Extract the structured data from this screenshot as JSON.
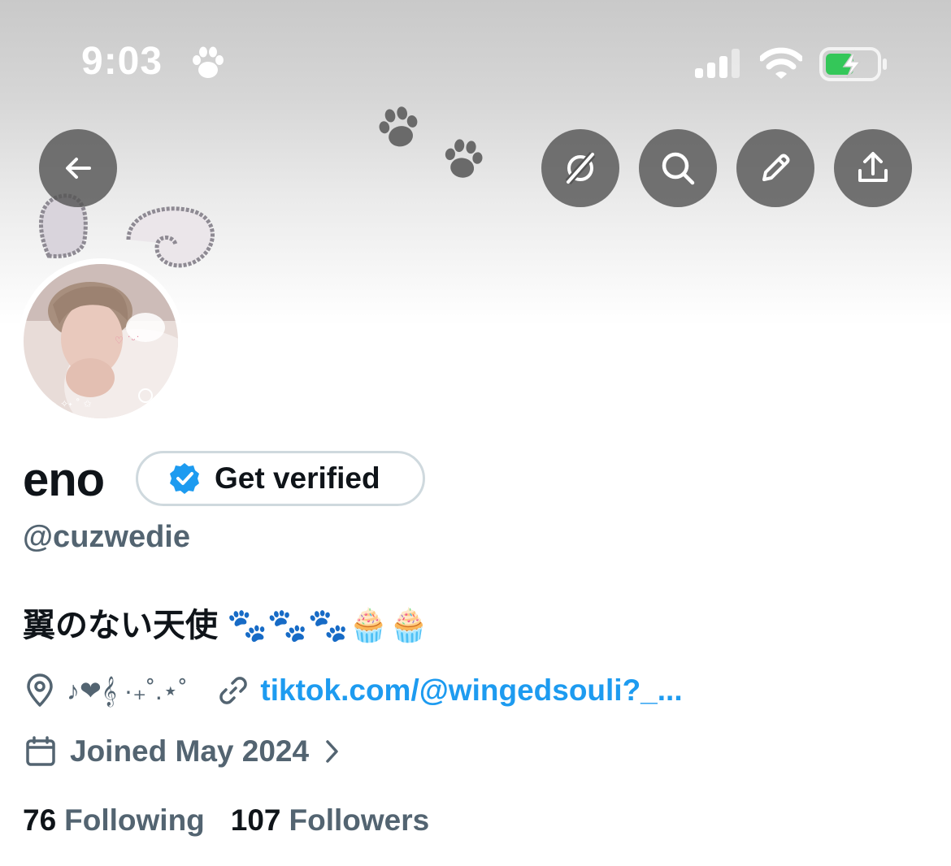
{
  "status_bar": {
    "time": "9:03",
    "time_icon": "paw-icon",
    "signal_icon": "cellular-signal-icon",
    "wifi_icon": "wifi-icon",
    "battery_icon": "battery-charging-icon"
  },
  "header": {
    "decorations": [
      "paw-icon",
      "paw-icon",
      "bunny-ears-doodle"
    ],
    "back_icon": "back-arrow-icon",
    "action_icons": [
      "grok-icon",
      "search-icon",
      "pencil-icon",
      "share-icon"
    ]
  },
  "profile": {
    "display_name": "eno",
    "verify_button_label": "Get verified",
    "verify_icon": "verified-badge-icon",
    "handle": "@cuzwedie",
    "bio": "翼のない天使 🐾🐾🐾🧁🧁",
    "location_icon": "location-pin-icon",
    "location": "♪❤𝄞 ·₊˚.⋆˚",
    "link_icon": "link-icon",
    "link": "tiktok.com/@wingedsouli?_...",
    "joined_icon": "calendar-icon",
    "joined": "Joined May 2024",
    "joined_chevron": "chevron-right-icon",
    "following_count": "76",
    "following_label": "Following",
    "followers_count": "107",
    "followers_label": "Followers"
  },
  "colors": {
    "text_primary": "#0f1419",
    "text_secondary": "#536471",
    "link": "#1d9bf0",
    "verify_blue": "#1d9bf0",
    "battery_green": "#34c759",
    "button_bg": "#555555"
  }
}
